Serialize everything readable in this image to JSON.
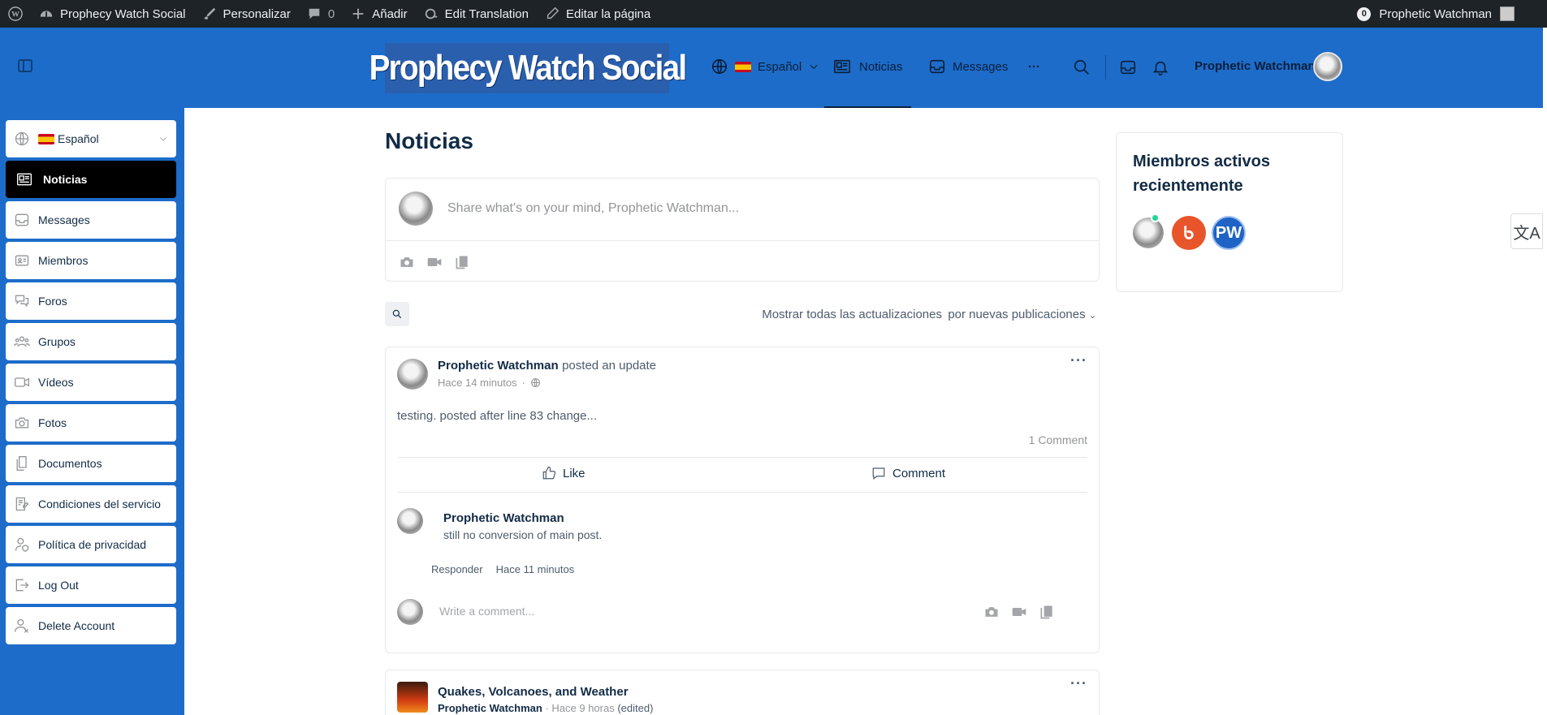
{
  "admin_bar": {
    "site_name": "Prophecy Watch Social",
    "customize": "Personalizar",
    "comments_count": "0",
    "add_new": "Añadir",
    "edit_translation": "Edit Translation",
    "edit_page": "Editar la página",
    "notifications_count": "0",
    "user": "Prophetic Watchman"
  },
  "header": {
    "logo_text": "Prophecy Watch Social",
    "language": "Español",
    "nav": [
      {
        "label": "Noticias",
        "icon": "newspaper-icon",
        "active": true
      },
      {
        "label": "Messages",
        "icon": "inbox-icon",
        "active": false
      }
    ],
    "more": "···",
    "user_name": "Prophetic Watchman"
  },
  "sidebar": {
    "language": "Español",
    "items": [
      {
        "label": "Noticias",
        "icon": "newspaper-icon",
        "active": true
      },
      {
        "label": "Messages",
        "icon": "inbox-icon"
      },
      {
        "label": "Miembros",
        "icon": "id-card-icon"
      },
      {
        "label": "Foros",
        "icon": "chat-bubbles-icon"
      },
      {
        "label": "Grupos",
        "icon": "group-icon"
      },
      {
        "label": "Vídeos",
        "icon": "video-icon"
      },
      {
        "label": "Fotos",
        "icon": "camera-icon"
      },
      {
        "label": "Documentos",
        "icon": "document-icon"
      },
      {
        "label": "Condiciones del servicio",
        "icon": "terms-icon"
      },
      {
        "label": "Política de privacidad",
        "icon": "privacy-icon"
      },
      {
        "label": "Log Out",
        "icon": "logout-icon"
      },
      {
        "label": "Delete Account",
        "icon": "delete-account-icon"
      }
    ]
  },
  "main": {
    "title": "Noticias",
    "composer_placeholder": "Share what's on your mind, Prophetic Watchman...",
    "filter_label": "Mostrar todas las actualizaciones",
    "filter_value": "por nuevas publicaciones",
    "post1": {
      "author": "Prophetic Watchman",
      "action": "posted an update",
      "time": "Hace 14 minutos",
      "body": "testing. posted after line 83 change...",
      "comment_count": "1 Comment",
      "like_label": "Like",
      "comment_label": "Comment",
      "comment": {
        "author": "Prophetic Watchman",
        "text": "still no conversion of main post.",
        "reply": "Responder",
        "time": "Hace 11 minutos"
      },
      "comment_placeholder": "Write a comment..."
    },
    "post2": {
      "title": "Quakes, Volcanoes, and Weather",
      "author": "Prophetic Watchman",
      "meta": "· Hace 9 horas",
      "edited": "(edited)"
    }
  },
  "widget": {
    "title": "Miembros activos recientemente",
    "members": [
      "avatar-eagle",
      "avatar-bb",
      "avatar-pw"
    ],
    "pw_initials": "PW"
  },
  "translate_glyph": "文A"
}
